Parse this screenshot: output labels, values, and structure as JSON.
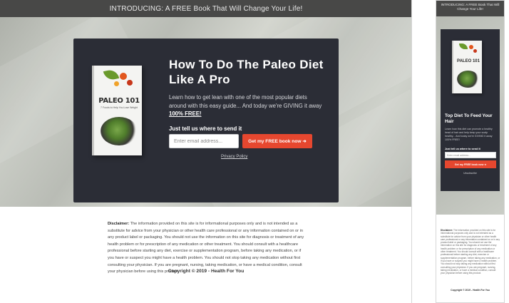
{
  "desktop": {
    "topbar_text": "INTRODUCING: A FREE Book That Will Change Your Life!",
    "book": {
      "title": "PALEO 101",
      "subtitle": "7 Foods to Help You Lose Weight"
    },
    "headline": "How To Do The Paleo Diet Like A Pro",
    "lede": "Learn how to get lean with one of the most popular diets around with this easy guide... And today we're GIVING it away",
    "lede_emphasis": "100% FREE!",
    "send_label": "Just tell us where to send it",
    "email_placeholder": "Enter email address...",
    "cta_label": "Get my FREE book now ➜",
    "privacy_label": "Privacy Policy",
    "disclaimer_label": "Disclaimer:",
    "disclaimer_text": "The information provided on this site is for informational purposes only and is not intended as a substitute for advice from your physician or other health care professional or any information contained on or in any product label or packaging. You should not use the information on this site for diagnosis or treatment of any health problem or for prescription of any medication or other treatment. You should consult with a healthcare professional before starting any diet, exercise or supplementation program, before taking any medication, or if you have or suspect you might have a health problem. You should not stop taking any medication without first consulting your physician. If you are pregnant, nursing, taking medication, or have a medical condition, consult your physician before using this product.",
    "copyright": "Copyright © 2019 - Health For You"
  },
  "mobile": {
    "topbar_text": "INTRODUCING: A FREE Book That Will Change Your Life!",
    "book_title": "PALEO 101",
    "headline": "Top Diet To Feed Your Hair",
    "lede": "Learn how this diet can promote a healthy head of hair and help keep your scalp healthy... And today we're GIVING it away 100% FREE!",
    "send_label": "Just tell us where to send it",
    "email_placeholder": "Enter email address...",
    "cta_label": "Get my FREE book now ➜",
    "privacy_label": "Unsubscribe",
    "disclaimer_label": "Disclaimer:",
    "disclaimer_text": "The information provided on this site is for informational purposes only and is not intended as a substitute for advice from your physician or other health care professional or any information contained on or in any product label or packaging. You should not use the information on this site for diagnosis or treatment of any health problem or for prescription of any medication or other treatment. You should consult with a healthcare professional before starting any diet, exercise or supplementation program, before taking any medication, or if you have or suspect you might have a health problem. You should not stop taking any medication without first consulting your physician. If you are pregnant, nursing, taking medication, or have a medical condition, consult your physician before using this product.",
    "copyright": "Copyright © 2019 - Health For You"
  },
  "colors": {
    "topbar": "#484847",
    "card": "#2b2d36",
    "cta": "#e6472f"
  }
}
